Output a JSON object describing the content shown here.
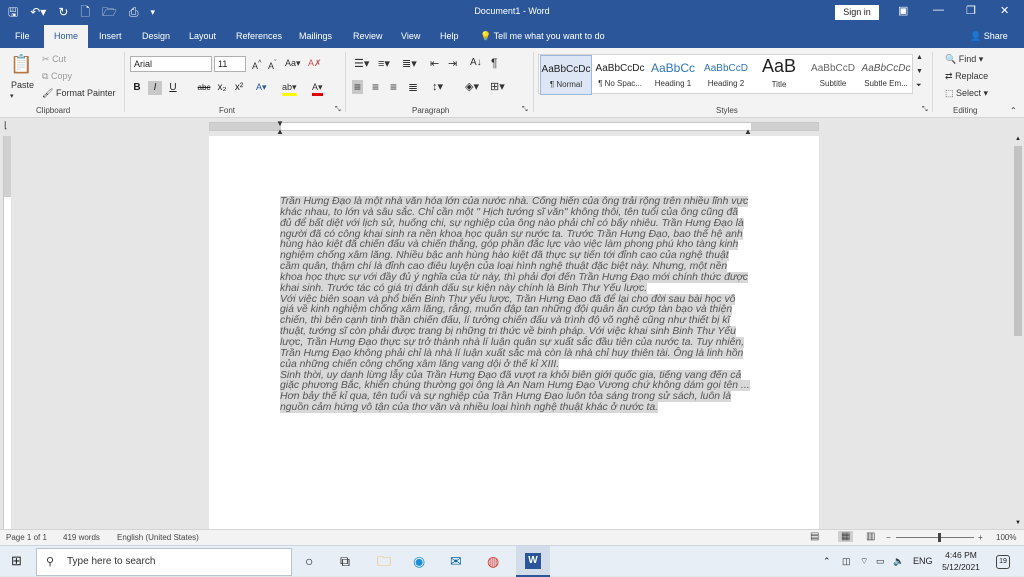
{
  "window": {
    "title": "Document1 - Word",
    "sign_in": "Sign in"
  },
  "tabs": [
    "File",
    "Home",
    "Insert",
    "Design",
    "Layout",
    "References",
    "Mailings",
    "Review",
    "View",
    "Help"
  ],
  "tell_me": "Tell me what you want to do",
  "share": "Share",
  "clipboard": {
    "paste": "Paste",
    "cut": "Cut",
    "copy": "Copy",
    "format_painter": "Format Painter",
    "label": "Clipboard"
  },
  "font": {
    "name": "Arial",
    "size": "11",
    "label": "Font",
    "buttons": [
      "B",
      "I",
      "U",
      "abc",
      "x₂",
      "x²"
    ]
  },
  "paragraph": {
    "label": "Paragraph"
  },
  "styles": {
    "label": "Styles",
    "items": [
      {
        "preview": "AaBbCcDc",
        "name": "¶ Normal"
      },
      {
        "preview": "AaBbCcDc",
        "name": "¶ No Spac..."
      },
      {
        "preview": "AaBbCc",
        "name": "Heading 1"
      },
      {
        "preview": "AaBbCcD",
        "name": "Heading 2"
      },
      {
        "preview": "AaB",
        "name": "Title"
      },
      {
        "preview": "AaBbCcD",
        "name": "Subtitle"
      },
      {
        "preview": "AaBbCcDc",
        "name": "Subtle Em..."
      }
    ]
  },
  "editing": {
    "find": "Find",
    "replace": "Replace",
    "select": "Select",
    "label": "Editing"
  },
  "document": {
    "paragraphs": [
      "Trần Hưng Đạo là một nhà văn hóa lớn của nước nhà. Cống hiến của ông trải rộng trên nhiều lĩnh vực khác nhau, to lớn và sâu sắc. Chỉ cần một \" Hịch tướng sĩ văn\" không thôi, tên tuổi của ông cũng đã đủ để bất diệt với lịch sử, huống chi, sự nghiệp của ông nào phải chỉ có bấy nhiêu. Trần Hưng Đạo là người đã có công khai sinh ra nền khoa học quân sự nước ta. Trước Trần Hưng Đạo, bao thế hệ anh hùng hào kiệt đã chiến đấu và chiến thắng, góp phần đắc lực vào việc làm phong phú kho tàng kinh nghiệm chống xâm lăng. Nhiều bậc anh hùng hào kiệt đã thực sự tiến tới đỉnh cao của nghệ thuật cầm quân, thậm chí là đỉnh cao điêu luyện của loại hình nghệ thuật đặc biệt này. Nhưng, một nền khoa học thực sự với đầy đủ ý nghĩa của từ này, thì phải đợi đến Trần Hưng Đạo mới chính thức được khai sinh. Trước tác có giá trị đánh dấu sự kiện này chính là Binh Thư Yếu lược.",
      "Với việc biên soạn và phổ biến Binh Thư yếu lược, Trần Hưng Đạo đã để lại cho đời sau bài học vô giá về kinh nghiệm chống xâm lăng, rằng, muốn đập tan những đội quân ăn cướp tàn bạo và thiện chiến, thì bên cạnh tinh thần chiến đấu, lí tưởng chiến đấu và trình độ võ nghệ cũng như thiết bị kĩ thuật, tướng sĩ còn phải được trang bị những tri thức về binh pháp. Với việc khai sinh Binh Thư Yếu lược, Trần Hưng Đạo thực sự trở thành nhà lí luận quân sự xuất sắc đầu tiên của nước ta. Tuy nhiên, Trần Hưng Đạo không phải chỉ là nhà lí luận xuất sắc mà còn là nhà chỉ huy thiên tài. Ông là linh hồn của những chiến công chống xâm lăng vang dội ở thế kỉ XIII.",
      "Sinh thời, uy danh lừng lẫy của Trần Hưng Đạo đã vượt ra khỏi biên giới quốc gia, tiếng vang đến cả giặc phương Bắc, khiến chúng thường gọi ông là An Nam Hưng Đạo Vương chứ không dám gọi tên ...",
      "Hơn bảy thế kỉ qua, tên tuổi và sự nghiệp của Trần Hưng Đạo luôn tỏa sáng trong sử sách, luôn là nguồn cảm hứng vô tận của thơ văn và nhiều loại hình nghệ thuật khác ở nước ta."
    ]
  },
  "status_bar": {
    "page": "Page 1 of 1",
    "words": "419 words",
    "language": "English (United States)",
    "zoom": "100%"
  },
  "taskbar": {
    "search_placeholder": "Type here to search",
    "lang": "ENG",
    "time": "4:46 PM",
    "date": "5/12/2021",
    "notifications": "19"
  },
  "colors": {
    "accent": "#2b579a",
    "ribbon": "#f3f3f3",
    "taskbar": "#e8eef6"
  }
}
